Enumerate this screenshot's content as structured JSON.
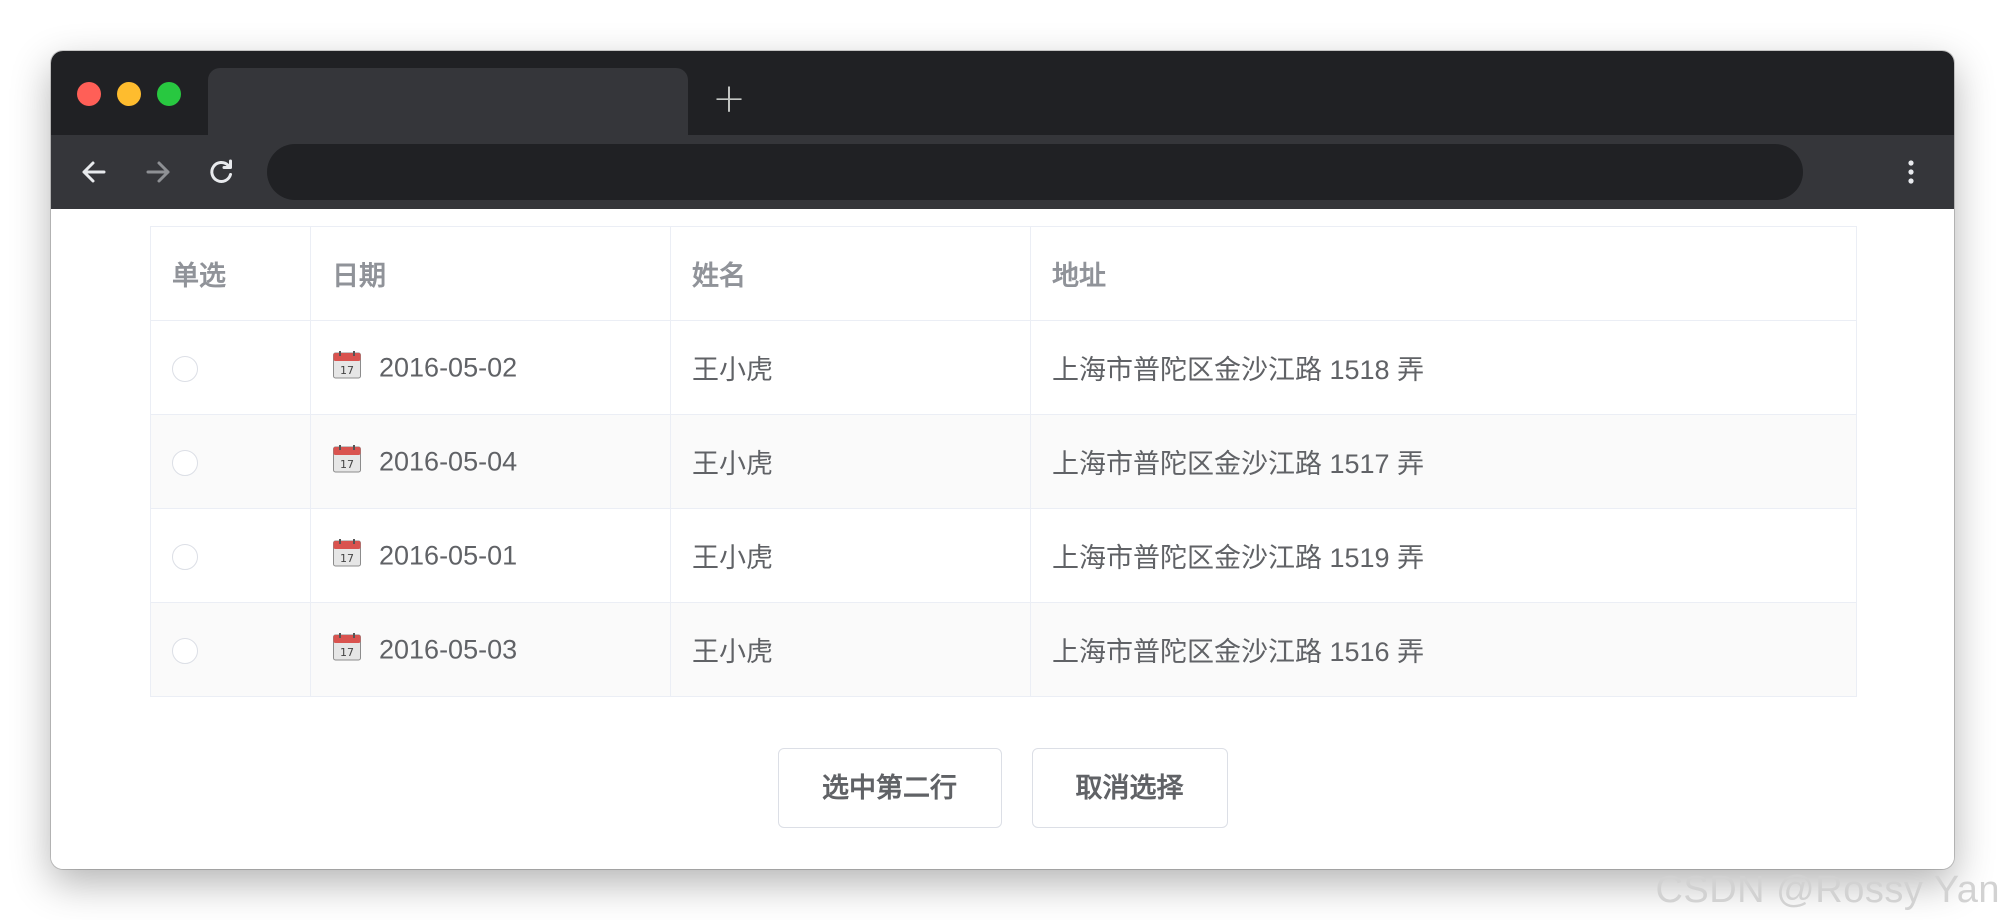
{
  "browser": {
    "icons": {
      "back": "arrow-left-icon",
      "forward": "arrow-right-icon",
      "reload": "reload-icon",
      "new_tab": "plus-icon",
      "menu": "more-vertical-icon"
    },
    "new_tab_label": "+"
  },
  "table": {
    "headers": {
      "select": "单选",
      "date": "日期",
      "name": "姓名",
      "address": "地址"
    },
    "rows": [
      {
        "date": "2016-05-02",
        "name": "王小虎",
        "address": "上海市普陀区金沙江路 1518 弄",
        "selected": false
      },
      {
        "date": "2016-05-04",
        "name": "王小虎",
        "address": "上海市普陀区金沙江路 1517 弄",
        "selected": false
      },
      {
        "date": "2016-05-01",
        "name": "王小虎",
        "address": "上海市普陀区金沙江路 1519 弄",
        "selected": false
      },
      {
        "date": "2016-05-03",
        "name": "王小虎",
        "address": "上海市普陀区金沙江路 1516 弄",
        "selected": false
      }
    ]
  },
  "actions": {
    "select_second_row": "选中第二行",
    "clear_selection": "取消选择"
  },
  "watermark": "CSDN @Rossy Yan",
  "colors": {
    "titlebar": "#202124",
    "toolbar": "#35363a",
    "border": "#ebeef5",
    "text": "#606266",
    "header_text": "#909399",
    "stripe": "#fafafa"
  }
}
